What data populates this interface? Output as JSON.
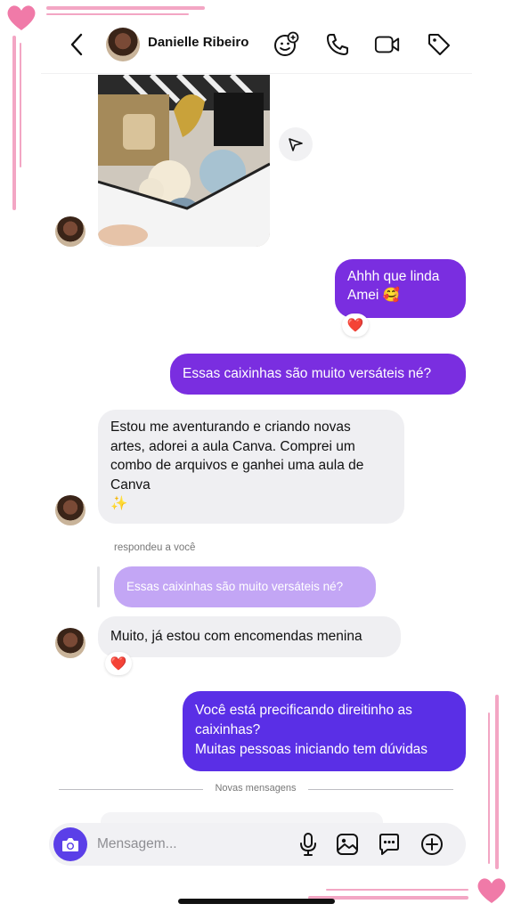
{
  "header": {
    "contact_name": "Danielle Ribeiro",
    "icons": [
      "back-icon",
      "add-people-icon",
      "phone-icon",
      "video-icon",
      "tag-icon"
    ]
  },
  "messages": [
    {
      "type": "image",
      "direction": "in",
      "icon": "share-icon"
    },
    {
      "type": "text",
      "direction": "out",
      "lines": [
        "Ahhh que linda",
        "Amei 🥰"
      ],
      "reaction": "❤️"
    },
    {
      "type": "text",
      "direction": "out",
      "text": "Essas caixinhas são muito versáteis né?"
    },
    {
      "type": "text",
      "direction": "in",
      "lines": [
        "Estou me aventurando e criando novas",
        "artes, adorei a aula Canva. Comprei um",
        "combo de arquivos e ganhei uma aula de",
        "Canva",
        "✨"
      ]
    },
    {
      "type": "reply",
      "direction": "in",
      "reply_label": "respondeu a você",
      "quoted_text": "Essas caixinhas são muito versáteis né?",
      "text": "Muito, já estou com encomendas menina",
      "reaction": "❤️"
    },
    {
      "type": "text",
      "direction": "out",
      "lines": [
        "Você está precificando direitinho as",
        "caixinhas?",
        "Muitas pessoas iniciando tem dúvidas"
      ]
    }
  ],
  "divider": {
    "label": "Novas mensagens"
  },
  "composer": {
    "placeholder": "Mensagem...",
    "icons": [
      "camera-icon",
      "microphone-icon",
      "gallery-icon",
      "sticker-icon",
      "plus-icon"
    ]
  },
  "colors": {
    "outgoing_bubble": "#7a2ee0",
    "outgoing_bubble_latest": "#5a2fe6",
    "incoming_bubble": "#efeff2",
    "reply_preview": "#c3a6f5",
    "camera_button": "#5b3fe8",
    "frame_decoration": "#f3a6c4"
  }
}
